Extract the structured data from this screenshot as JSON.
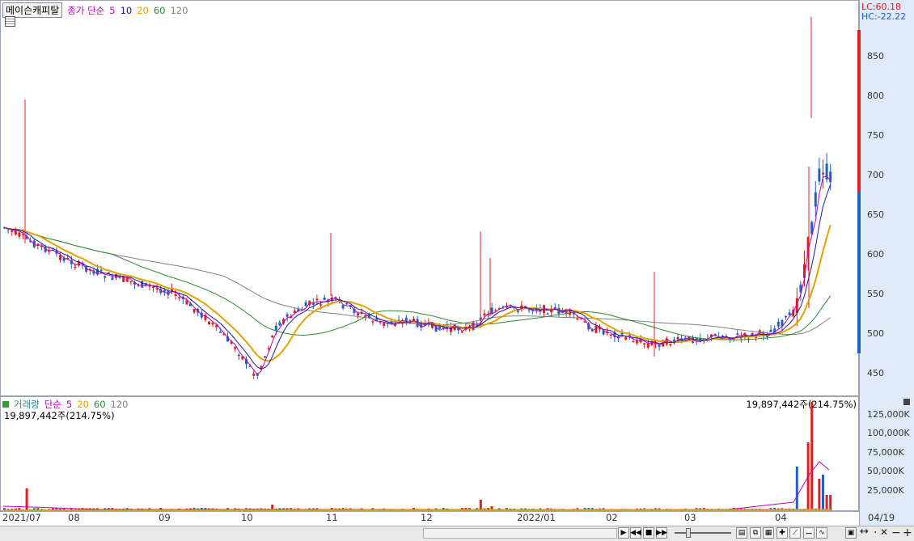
{
  "stock": {
    "name": "메이슨캐피탈",
    "ma_title": "종가 단순",
    "ma_periods": [
      "5",
      "10",
      "20",
      "60",
      "120"
    ]
  },
  "price_axis": {
    "lc": "LC:60.18",
    "hc": "HC:-22.22",
    "ticks": [
      "850",
      "800",
      "750",
      "700",
      "650",
      "600",
      "550",
      "500",
      "450"
    ]
  },
  "volume": {
    "title": "거래량",
    "ma_title": "단순",
    "ma_periods": [
      "5",
      "20",
      "60",
      "120"
    ],
    "current_left": "19,897,442주(214.75%)",
    "current_right": "19,897,442주(214.75%)",
    "ticks": [
      "125,000K",
      "100,000K",
      "75,000K",
      "50,000K",
      "25,000K"
    ]
  },
  "x_axis": [
    "2021/07",
    "08",
    "09",
    "10",
    "11",
    "12",
    "2022/01",
    "02",
    "03",
    "04"
  ],
  "date_label": "04/19",
  "colors": {
    "ma5": "#c000c0",
    "ma10": "#1a1aa0",
    "ma20": "#e6a000",
    "ma60": "#2a8a2a",
    "ma120": "#808080",
    "up": "#e02020",
    "down": "#2060c0"
  },
  "icons": [
    "grid-icon",
    "play-icon",
    "rewind-icon",
    "stop-icon",
    "fast-forward-icon"
  ]
}
